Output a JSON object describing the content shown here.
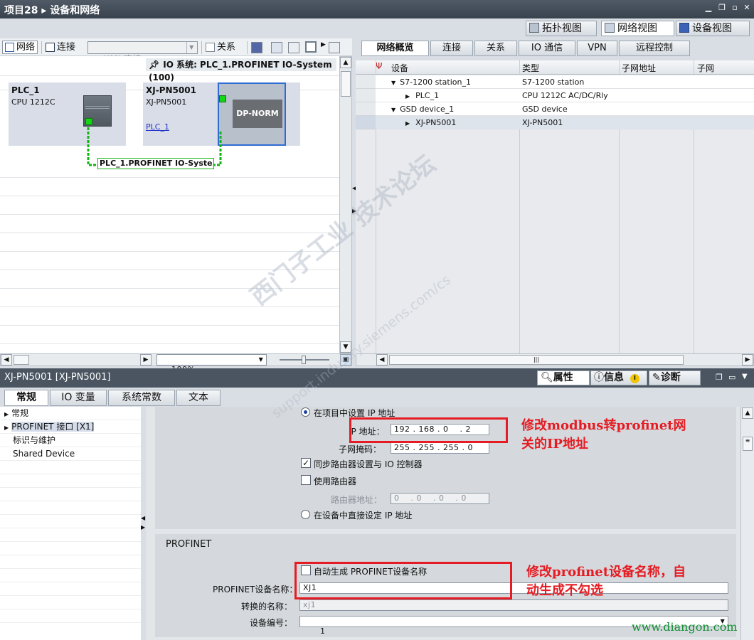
{
  "window": {
    "title": "项目28 ▸ 设备和网络"
  },
  "view_tabs": [
    {
      "label": "拓扑视图"
    },
    {
      "label": "网络视图"
    },
    {
      "label": "设备视图"
    }
  ],
  "left_toolbar": {
    "network": "网络",
    "connect": "连接",
    "connect_type": "HMI 连接",
    "relation": "关系"
  },
  "io_system_header": "IO 系统: PLC_1.PROFINET IO-System (100)",
  "devices": {
    "plc": {
      "name": "PLC_1",
      "model": "CPU 1212C"
    },
    "gsd": {
      "name": "XJ-PN5001",
      "model": "XJ-PN5001",
      "link": "PLC_1",
      "module": "DP-NORM"
    }
  },
  "network_label": "PLC_1.PROFINET IO-Syste...",
  "zoom": "100%",
  "right_tabs": [
    {
      "label": "网络概览"
    },
    {
      "label": "连接"
    },
    {
      "label": "关系"
    },
    {
      "label": "IO 通信"
    },
    {
      "label": "VPN"
    },
    {
      "label": "远程控制"
    }
  ],
  "grid": {
    "headers": {
      "device": "设备",
      "type": "类型",
      "subnet_addr": "子网地址",
      "subnet": "子网"
    },
    "rows": [
      {
        "device": "S7-1200 station_1",
        "type": "S7-1200 station"
      },
      {
        "device": "PLC_1",
        "type": "CPU 1212C AC/DC/Rly"
      },
      {
        "device": "GSD device_1",
        "type": "GSD device"
      },
      {
        "device": "XJ-PN5001",
        "type": "XJ-PN5001"
      }
    ]
  },
  "properties": {
    "title": "XJ-PN5001 [XJ-PN5001]",
    "top_tabs": {
      "props": "属性",
      "info": "信息",
      "diag": "诊断"
    },
    "tabs": [
      {
        "label": "常规"
      },
      {
        "label": "IO 变量"
      },
      {
        "label": "系统常数"
      },
      {
        "label": "文本"
      }
    ],
    "nav": [
      {
        "label": "常规"
      },
      {
        "label": "PROFINET 接口 [X1]"
      },
      {
        "label": "标识与维护"
      },
      {
        "label": "Shared Device"
      }
    ],
    "ip": {
      "set_in_project": "在项目中设置 IP 地址",
      "ip_label": "IP 地址：",
      "ip_value": "192 . 168 . 0    . 2",
      "mask_label": "子网掩码：",
      "mask_value": "255 . 255 . 255 . 0",
      "sync_router": "同步路由器设置与 IO 控制器",
      "use_router": "使用路由器",
      "router_label": "路由器地址：",
      "router_value": "0    . 0    . 0    . 0",
      "set_on_device": "在设备中直接设定 IP 地址"
    },
    "profinet": {
      "section": "PROFINET",
      "auto_name": "自动生成 PROFINET设备名称",
      "name_label": "PROFINET设备名称：",
      "name_value": "XJ1",
      "converted_label": "转换的名称：",
      "converted_value": "xj1",
      "number_label": "设备编号：",
      "number_value": "1"
    }
  },
  "annotations": {
    "ip_note": [
      "修改modbus转profinet网",
      "关的IP地址"
    ],
    "name_note": [
      "修改profinet设备名称，自",
      "动生成不勾选"
    ],
    "color": "#e51c23"
  },
  "watermark": {
    "line1": "西门子工业 技术论坛",
    "line2": "support.industry.siemens.com/cs"
  },
  "footer_url": "www.diangon.com"
}
